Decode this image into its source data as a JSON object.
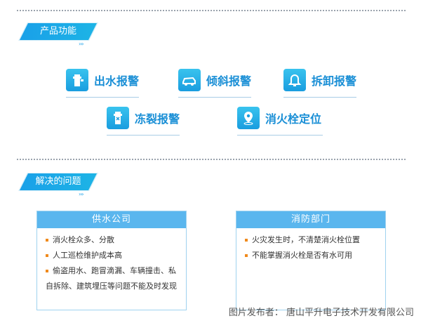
{
  "section1": {
    "title": "产品功能",
    "arrows": "›››"
  },
  "features": [
    {
      "label": "出水报警",
      "icon": "hydrant-water-icon"
    },
    {
      "label": "倾斜报警",
      "icon": "tilted-car-icon"
    },
    {
      "label": "拆卸报警",
      "icon": "bell-icon"
    },
    {
      "label": "冻裂报警",
      "icon": "frozen-hydrant-icon"
    },
    {
      "label": "消火栓定位",
      "icon": "location-pin-icon"
    }
  ],
  "section2": {
    "title": "解决的问题",
    "arrows": "›››"
  },
  "cards": [
    {
      "title": "供水公司",
      "items": [
        "消火栓众多、分散",
        "人工巡检维护成本高",
        "偷盗用水、跑冒滴漏、车辆撞击、私",
        "自拆除、建筑埋压等问题不能及时发现"
      ]
    },
    {
      "title": "消防部门",
      "items": [
        "火灾发生时，不清楚消火栓位置",
        "不能掌握消火栓是否有水可用"
      ]
    }
  ],
  "source": "图片发布者：  唐山平升电子技术开发有限公司",
  "colors": {
    "accent": "#1aa0e8",
    "feature_text": "#1a8fd6",
    "card_head": "#5ab6ee",
    "bullet": "#f08a1c"
  }
}
